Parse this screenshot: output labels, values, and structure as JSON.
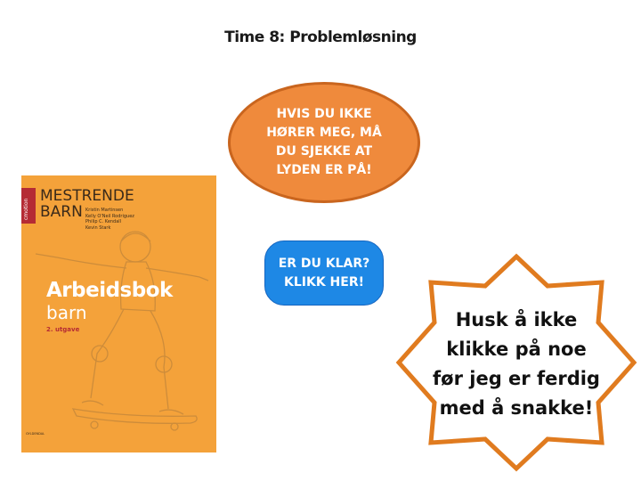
{
  "slide": {
    "title": "Time 8: Problemløsning",
    "audio_notice": "HVIS DU IKKE\nHØRER MEG, MÅ\nDU SJEKKE AT\nLYDEN ER PÅ!",
    "start_button_label": "ER DU KLAR?\nKLIKK HER!",
    "reminder": "Husk å ikke\nklikke på noe\nfør jeg er ferdig\nmed å snakke!"
  },
  "book": {
    "side_label": "cmotion",
    "series": "MESTRENDE\nBARN",
    "authors": [
      "Kristin Martinsen",
      "Kelly O'Neil Rodriguez",
      "Philip C. Kendall",
      "Kevin Stark"
    ],
    "title": "Arbeidsbok",
    "subtitle": "barn",
    "edition": "2. utgave",
    "publisher": "GYLDENDAL"
  },
  "colors": {
    "oval_fill": "#ef8a3c",
    "button_fill": "#1e88e5",
    "book_cover": "#f4a23a",
    "star_stroke": "#e07b1f"
  }
}
